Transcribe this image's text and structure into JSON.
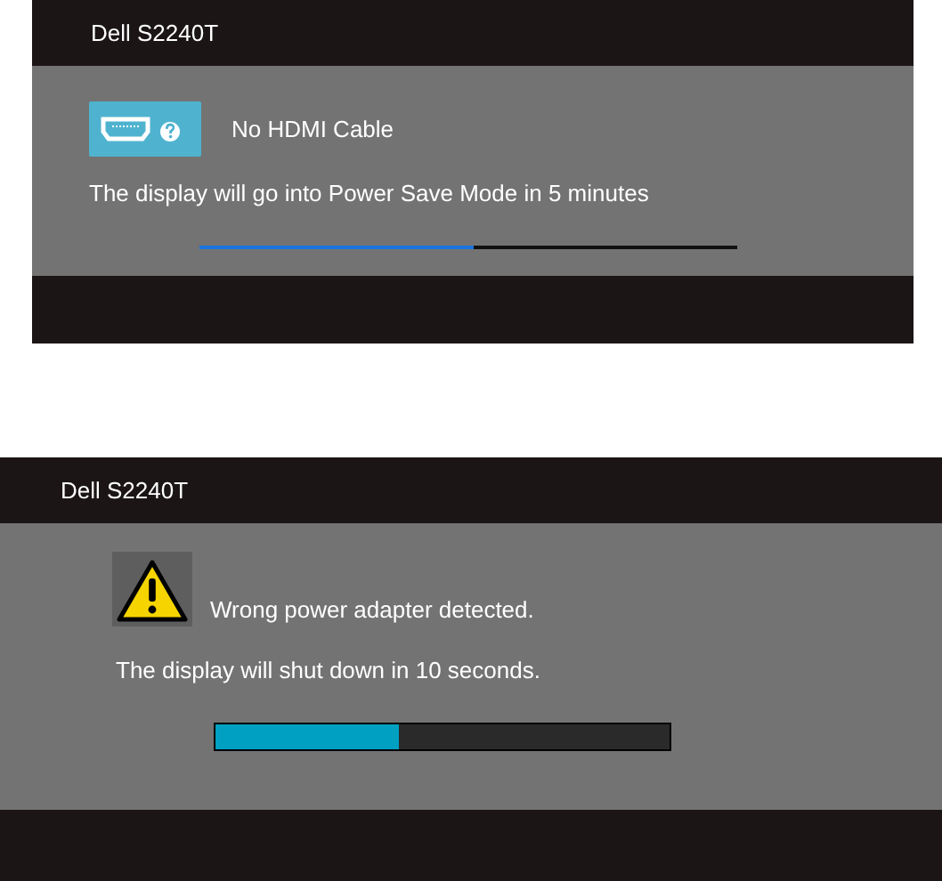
{
  "dialogs": [
    {
      "kind": "no-cable",
      "title": "Dell S2240T",
      "message": "No HDMI Cable",
      "note": "The display will go into Power Save Mode in 5 minutes",
      "progress": {
        "level": 0.51
      }
    },
    {
      "kind": "warning",
      "title": "Dell S2240T",
      "message": "Wrong power adapter detected.",
      "note": "The display will shut down in 10 seconds.",
      "progress": {
        "level": 0.405
      }
    }
  ]
}
